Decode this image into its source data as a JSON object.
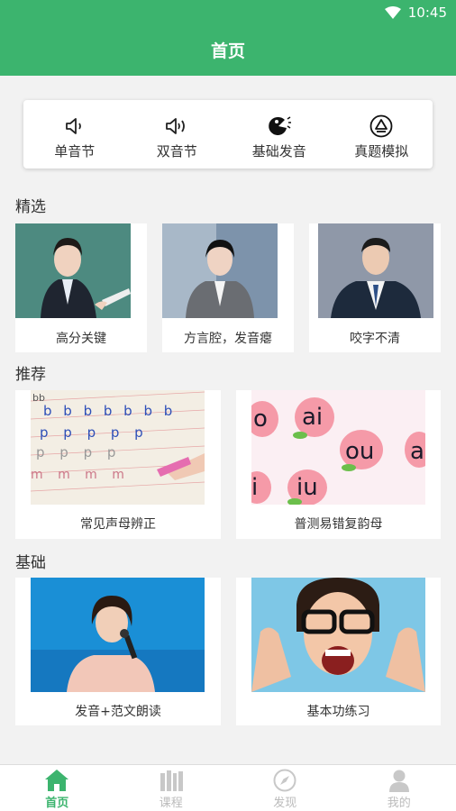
{
  "status": {
    "time": "10:45"
  },
  "header": {
    "title": "首页"
  },
  "quick_menu": [
    {
      "label": "单音节",
      "icon": "speaker-low-icon"
    },
    {
      "label": "双音节",
      "icon": "speaker-high-icon"
    },
    {
      "label": "基础发音",
      "icon": "mouth-sound-icon"
    },
    {
      "label": "真题模拟",
      "icon": "exam-triangle-icon"
    }
  ],
  "sections": {
    "featured": {
      "title": "精选",
      "items": [
        {
          "caption": "高分关键"
        },
        {
          "caption": "方言腔，发音瘪"
        },
        {
          "caption": "咬字不清"
        }
      ]
    },
    "recommended": {
      "title": "推荐",
      "items": [
        {
          "caption": "常见声母辨正"
        },
        {
          "caption": "普测易错复韵母"
        }
      ],
      "image_text": {
        "handwriting": [
          "bb",
          "b b b b b b b",
          "p p p p p",
          "p p p p",
          "m m m m"
        ],
        "peaches": [
          "o",
          "ai",
          "ou",
          "a",
          "i",
          "iu"
        ]
      }
    },
    "basics": {
      "title": "基础",
      "items": [
        {
          "caption": "发音+范文朗读"
        },
        {
          "caption": "基本功练习"
        }
      ]
    }
  },
  "tabbar": [
    {
      "label": "首页",
      "icon": "home-icon",
      "active": true
    },
    {
      "label": "课程",
      "icon": "books-icon",
      "active": false
    },
    {
      "label": "发现",
      "icon": "compass-icon",
      "active": false
    },
    {
      "label": "我的",
      "icon": "user-icon",
      "active": false
    }
  ],
  "colors": {
    "brand": "#3cb46e",
    "inactive": "#bbbbbb"
  }
}
